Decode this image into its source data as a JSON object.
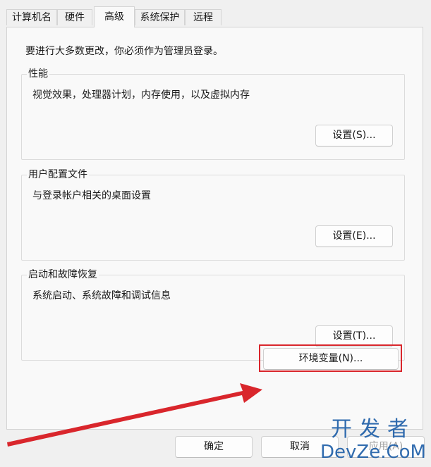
{
  "tabs": [
    {
      "label": "计算机名",
      "active": false
    },
    {
      "label": "硬件",
      "active": false
    },
    {
      "label": "高级",
      "active": true
    },
    {
      "label": "系统保护",
      "active": false
    },
    {
      "label": "远程",
      "active": false
    }
  ],
  "admin_note": "要进行大多数更改，你必须作为管理员登录。",
  "performance": {
    "title": "性能",
    "description": "视觉效果，处理器计划，内存使用，以及虚拟内存",
    "button": "设置(S)..."
  },
  "user_profiles": {
    "title": "用户配置文件",
    "description": "与登录帐户相关的桌面设置",
    "button": "设置(E)..."
  },
  "startup_recovery": {
    "title": "启动和故障恢复",
    "description": "系统启动、系统故障和调试信息",
    "button": "设置(T)..."
  },
  "env_button": "环境变量(N)...",
  "footer": {
    "ok": "确定",
    "cancel": "取消",
    "apply": "应用(A)"
  },
  "watermark": {
    "cn": "开发者",
    "en": "DevZe.CoM"
  },
  "colors": {
    "highlight": "#d9262c",
    "arrow": "#d9262c",
    "watermark": "#1f5fa8"
  }
}
